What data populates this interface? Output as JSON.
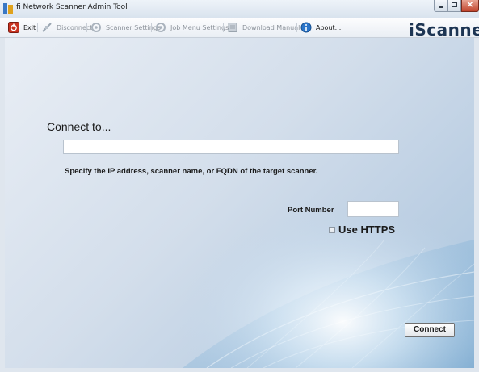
{
  "window": {
    "title": "fi Network Scanner Admin Tool",
    "icon": "app-icon",
    "controls": {
      "minimize_icon": "minimize-icon",
      "maximize_icon": "maximize-icon",
      "close_icon": "close-icon",
      "close_glyph": "✕"
    }
  },
  "toolbar": {
    "items": [
      {
        "label": "Exit",
        "icon": "exit-icon",
        "enabled": true
      },
      {
        "label": "Disconnect",
        "icon": "disconnect-icon",
        "enabled": false
      },
      {
        "label": "Scanner Settings",
        "icon": "scanner-settings-icon",
        "enabled": false
      },
      {
        "label": "Job Menu Settings",
        "icon": "job-menu-settings-icon",
        "enabled": false
      },
      {
        "label": "Download Manual",
        "icon": "download-manual-icon",
        "enabled": false
      },
      {
        "label": "About...",
        "icon": "about-icon",
        "enabled": true
      }
    ],
    "logo_i": "i",
    "logo_text": "Scanner"
  },
  "connect": {
    "title": "Connect to...",
    "host_value": "",
    "hint": "Specify the IP address, scanner name, or FQDN of the target scanner.",
    "port_label": "Port Number",
    "port_value": "",
    "https_label": "Use HTTPS",
    "https_checked": false,
    "button_label": "Connect"
  },
  "colors": {
    "accent": "#1d3553",
    "background_light": "#e9eef5",
    "background_dark": "#a9c6df"
  }
}
